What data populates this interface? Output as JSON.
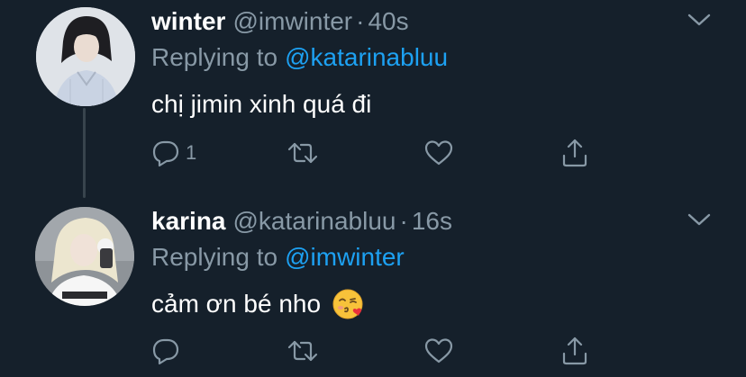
{
  "colors": {
    "background": "#15202b",
    "primary_text": "#ffffff",
    "secondary_text": "#8899a6",
    "link": "#1da1f2",
    "thread_line": "#38444d"
  },
  "tweets": [
    {
      "name": "winter",
      "handle": "@imwinter",
      "separator": "·",
      "time": "40s",
      "reply_prefix": "Replying to",
      "reply_to": "@katarinabluu",
      "text": "chị jimin xinh quá đi",
      "reply_count": "1",
      "icons": [
        "chevron-down-icon",
        "reply-icon",
        "retweet-icon",
        "like-icon",
        "share-icon"
      ]
    },
    {
      "name": "karina",
      "handle": "@katarinabluu",
      "separator": "·",
      "time": "16s",
      "reply_prefix": "Replying to",
      "reply_to": "@imwinter",
      "text": "cảm ơn bé nho",
      "emoji": "kissing-face-emoji",
      "icons": [
        "chevron-down-icon",
        "reply-icon",
        "retweet-icon",
        "like-icon",
        "share-icon"
      ]
    }
  ]
}
